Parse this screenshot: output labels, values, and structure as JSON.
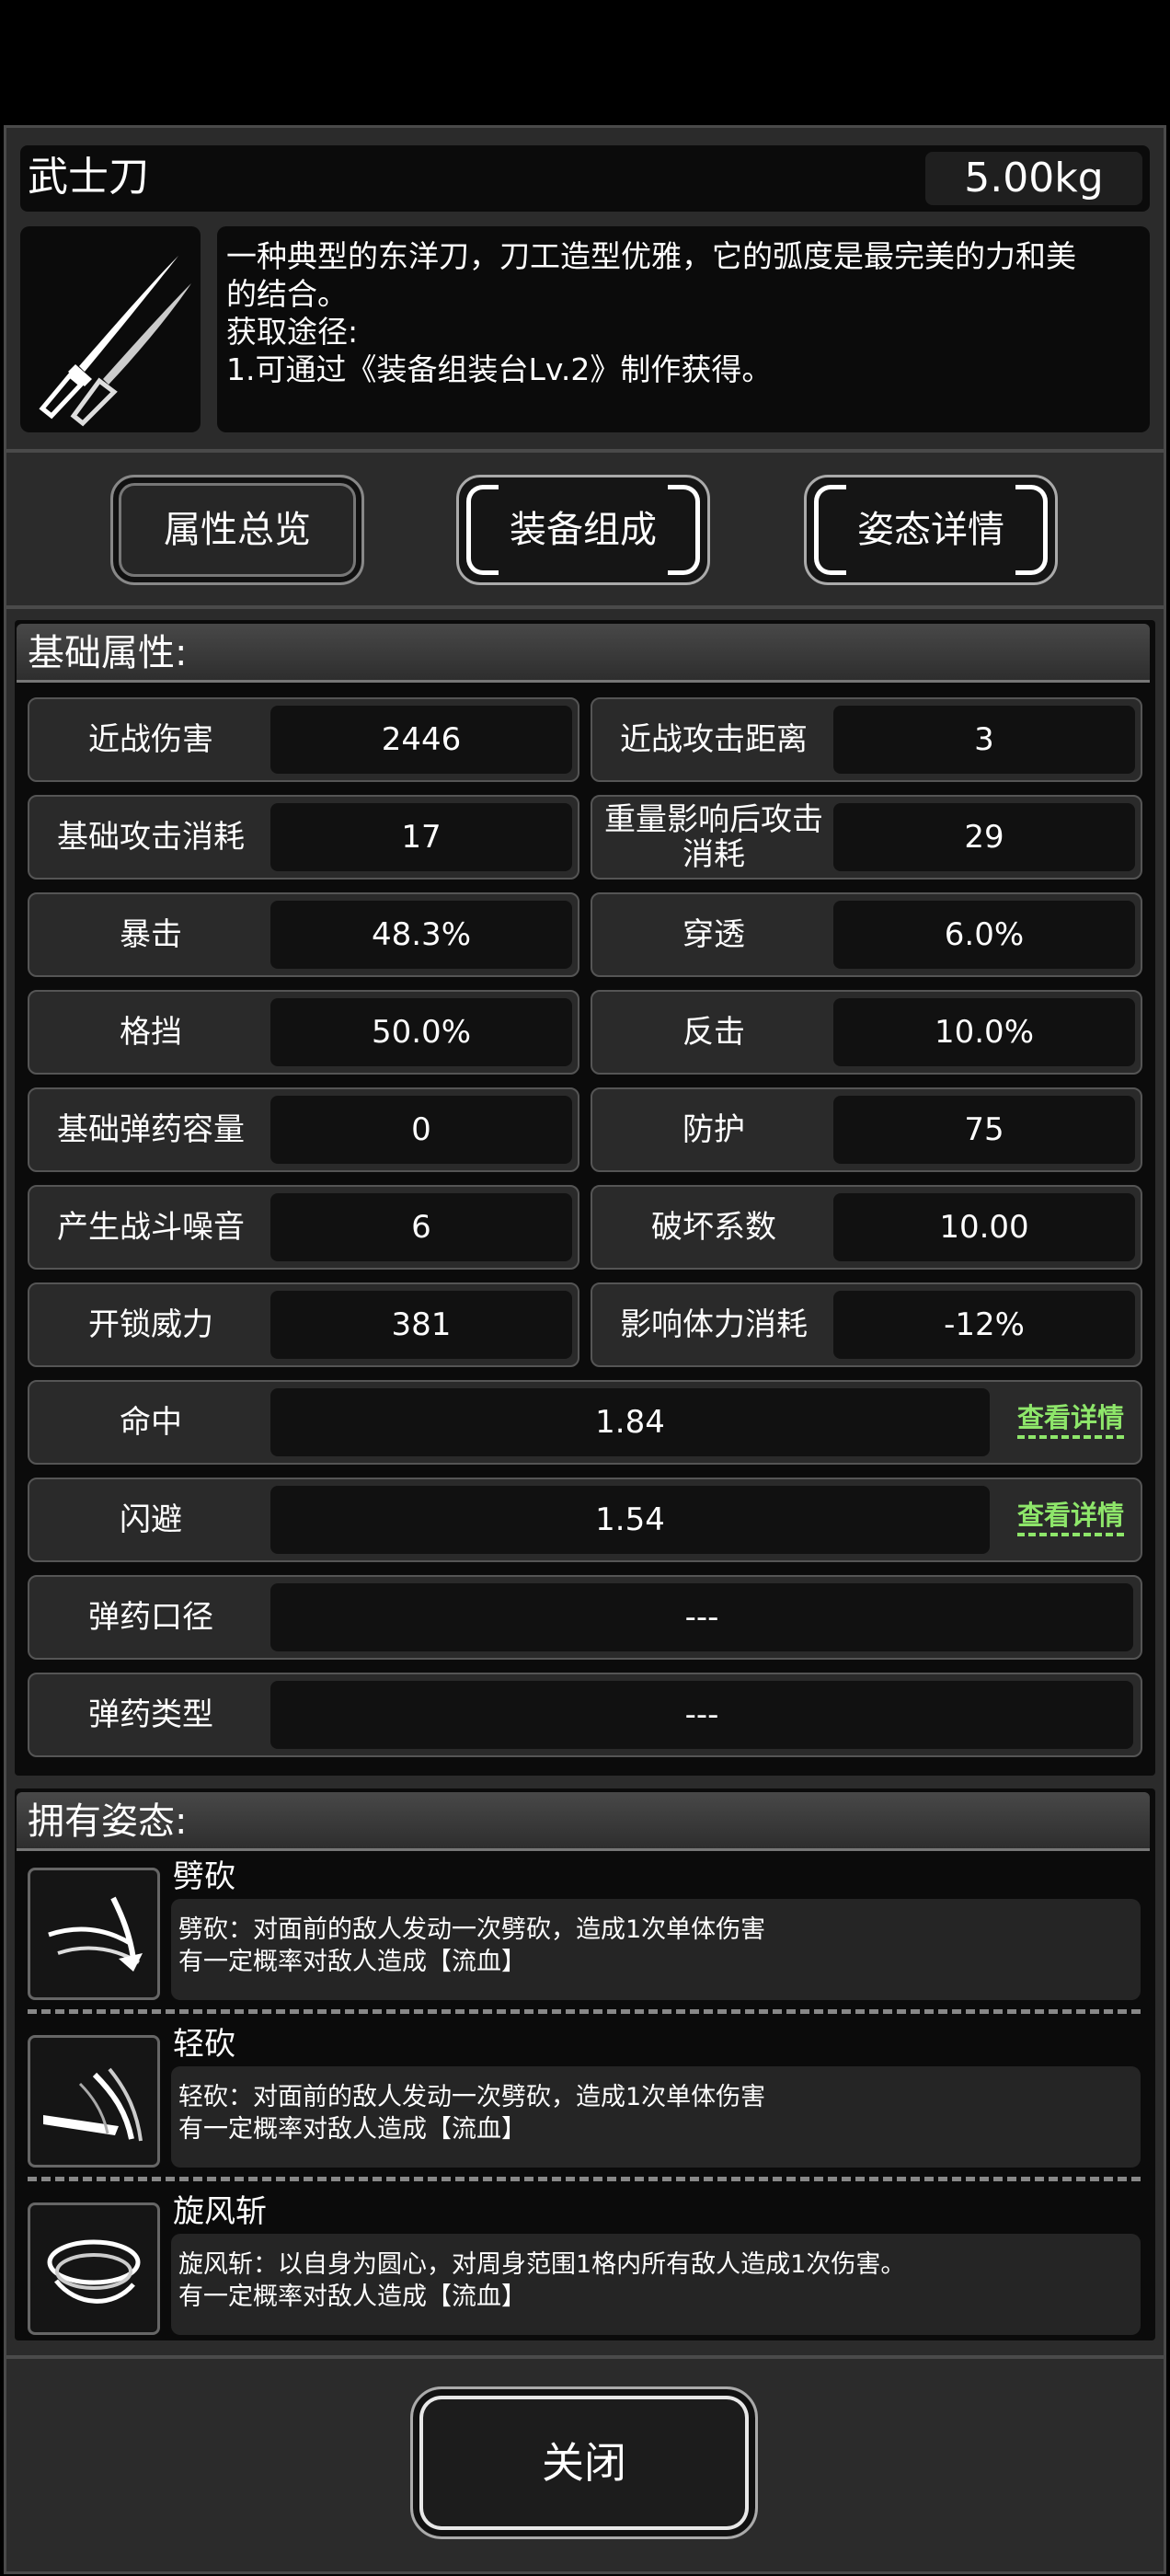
{
  "item": {
    "name": "武士刀",
    "weight": "5.00kg",
    "description_lines": [
      "一种典型的东洋刀，刀工造型优雅，它的弧度是最完美的力和美",
      "的结合。",
      "获取途径:",
      "1.可通过《装备组装台Lv.2》制作获得。"
    ]
  },
  "tabs": [
    {
      "label": "属性总览"
    },
    {
      "label": "装备组成"
    },
    {
      "label": "姿态详情"
    }
  ],
  "basic_attributes": {
    "title": "基础属性:",
    "pairs": [
      {
        "label": "近战伤害",
        "value": "2446"
      },
      {
        "label": "近战攻击距离",
        "value": "3"
      },
      {
        "label": "基础攻击消耗",
        "value": "17"
      },
      {
        "label": "重量影响后攻击消耗",
        "value": "29"
      },
      {
        "label": "暴击",
        "value": "48.3%"
      },
      {
        "label": "穿透",
        "value": "6.0%"
      },
      {
        "label": "格挡",
        "value": "50.0%"
      },
      {
        "label": "反击",
        "value": "10.0%"
      },
      {
        "label": "基础弹药容量",
        "value": "0"
      },
      {
        "label": "防护",
        "value": "75"
      },
      {
        "label": "产生战斗噪音",
        "value": "6"
      },
      {
        "label": "破坏系数",
        "value": "10.00"
      },
      {
        "label": "开锁威力",
        "value": "381"
      },
      {
        "label": "影响体力消耗",
        "value": "-12%"
      }
    ],
    "wide": [
      {
        "label": "命中",
        "value": "1.84",
        "link": "查看详情"
      },
      {
        "label": "闪避",
        "value": "1.54",
        "link": "查看详情"
      },
      {
        "label": "弹药口径",
        "value": "---"
      },
      {
        "label": "弹药类型",
        "value": "---"
      }
    ]
  },
  "stances": {
    "title": "拥有姿态:",
    "items": [
      {
        "name": "劈砍",
        "line1": "劈砍：对面前的敌人发动一次劈砍，造成1次单体伤害",
        "line2": "有一定概率对敌人造成【流血】",
        "icon": "slash-icon"
      },
      {
        "name": "轻砍",
        "line1": "轻砍：对面前的敌人发动一次劈砍，造成1次单体伤害",
        "line2": "有一定概率对敌人造成【流血】",
        "icon": "light-slash-icon"
      },
      {
        "name": "旋风斩",
        "line1": "旋风斩：以自身为圆心，对周身范围1格内所有敌人造成1次伤害。",
        "line2": "有一定概率对敌人造成【流血】",
        "icon": "whirlwind-icon"
      }
    ]
  },
  "close_label": "关闭"
}
